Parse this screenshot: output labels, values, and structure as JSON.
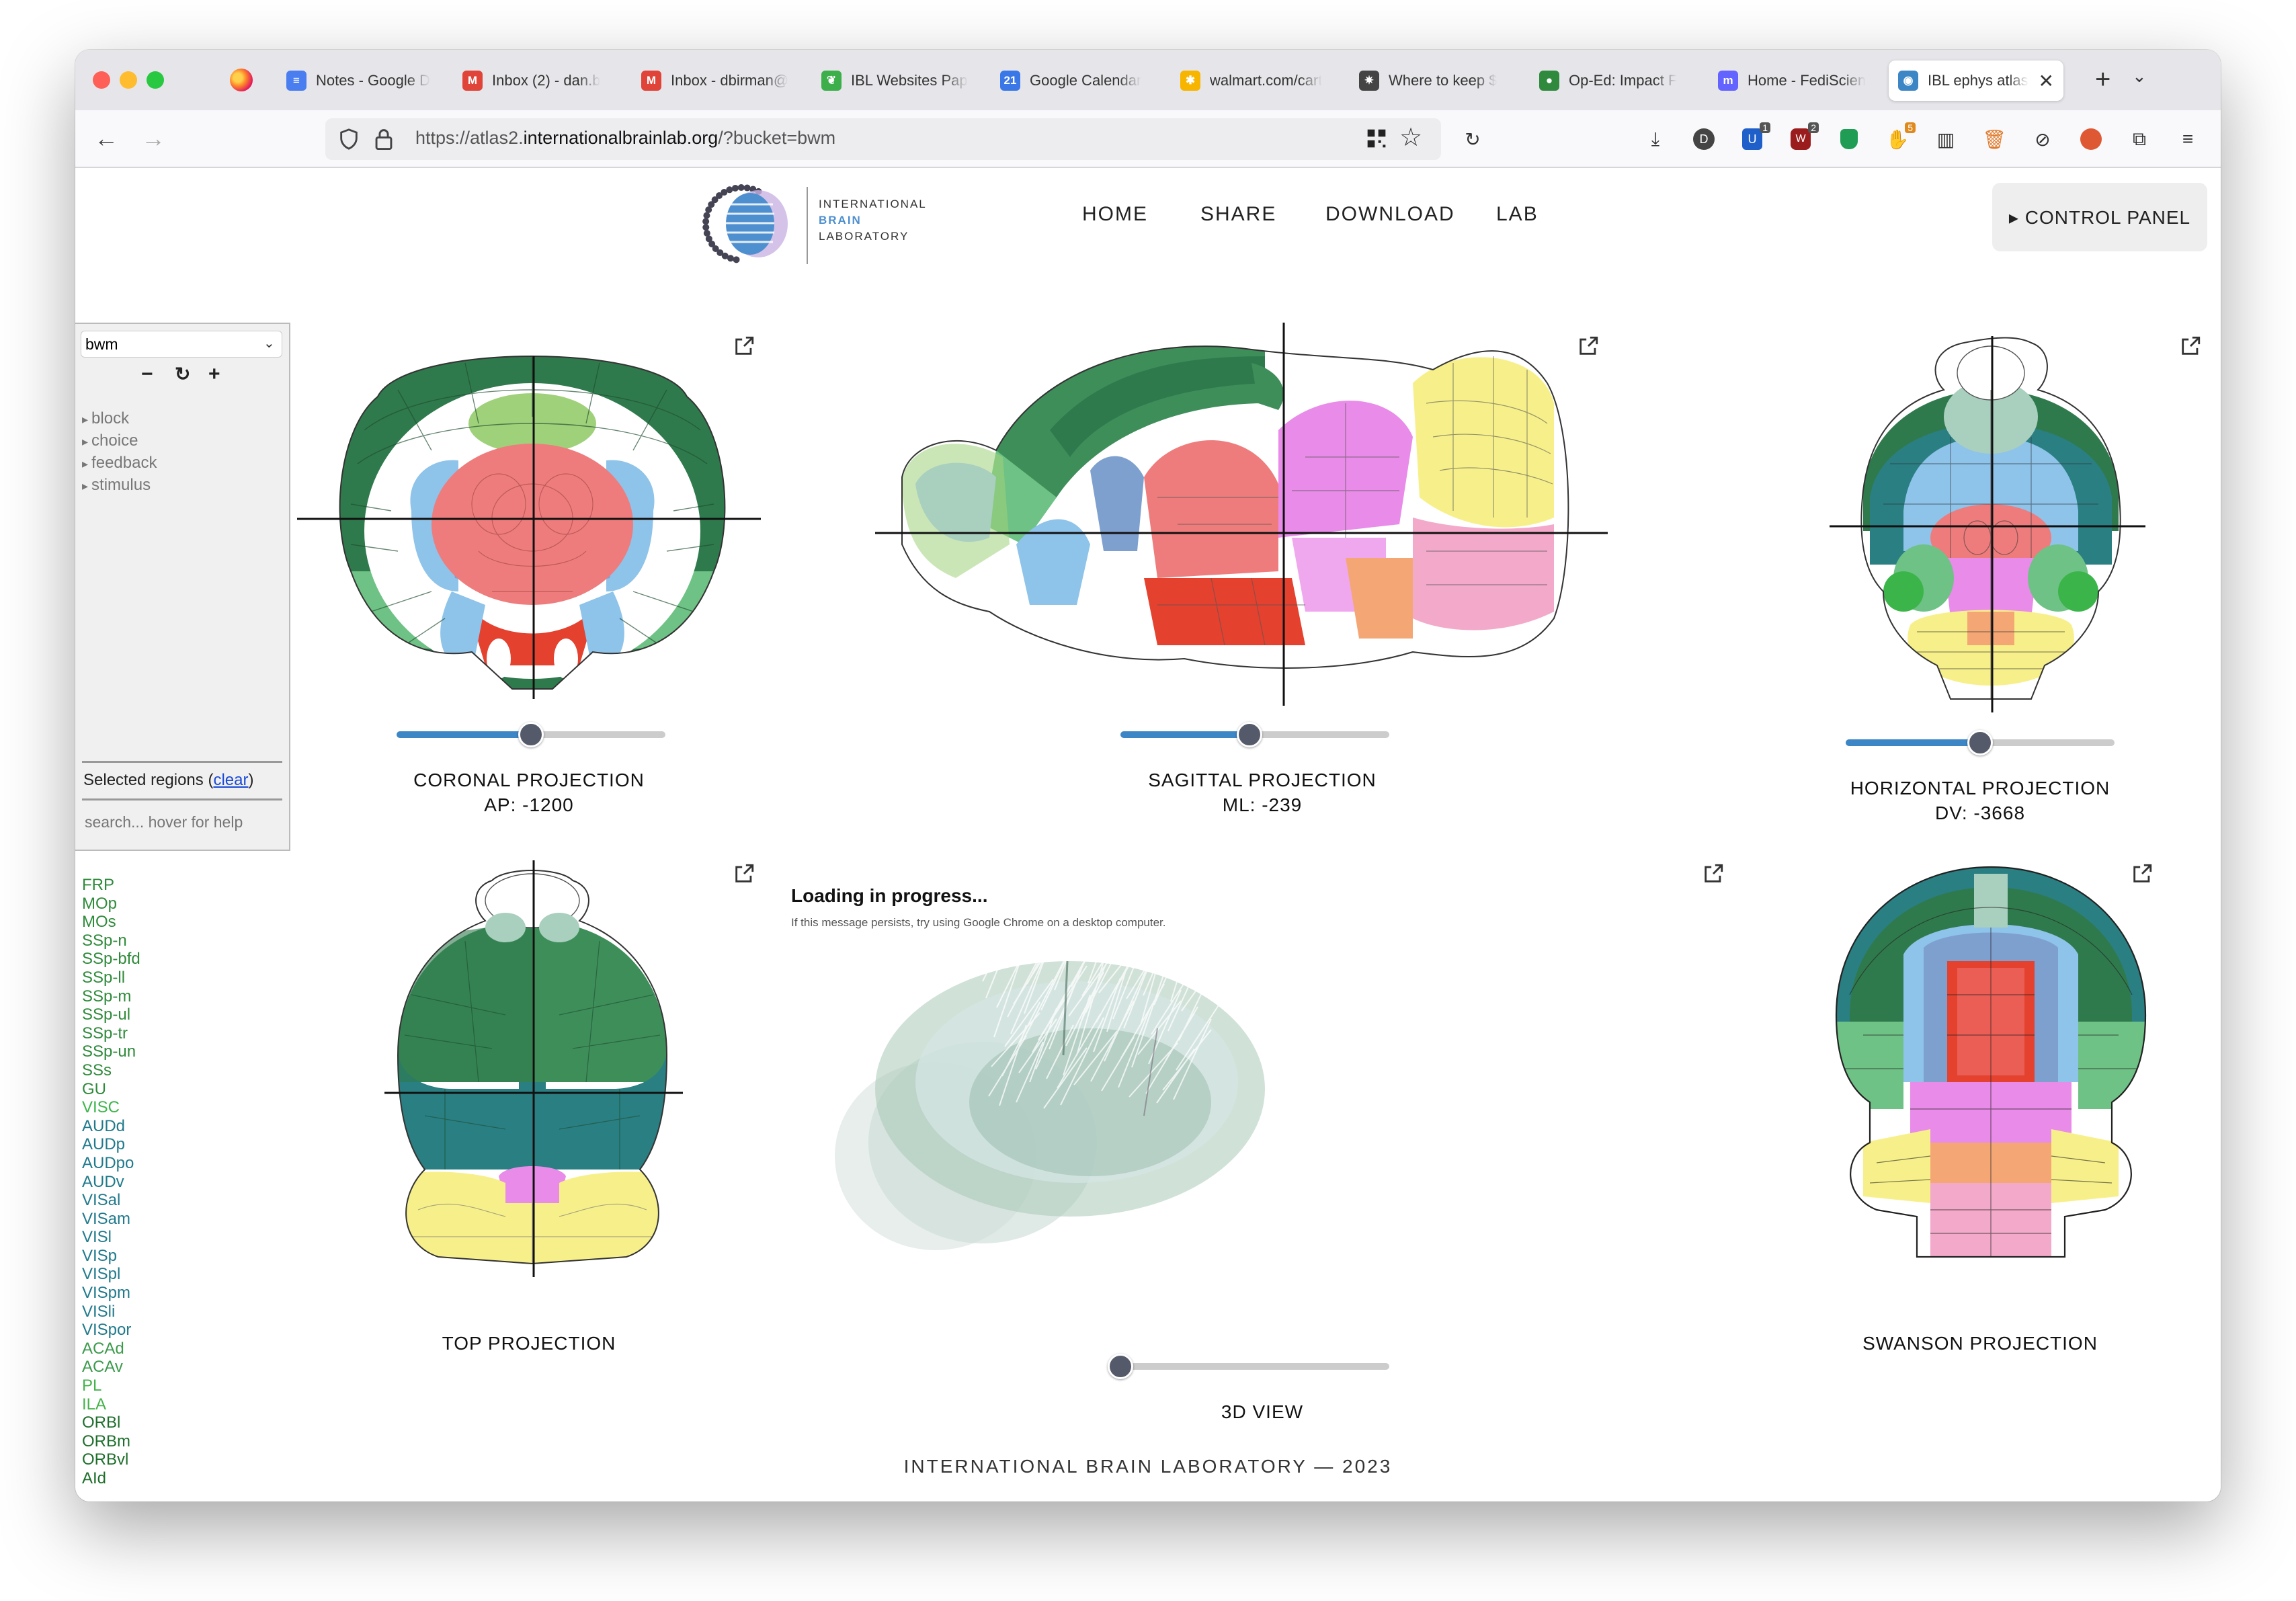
{
  "browser": {
    "tabs": [
      {
        "title": "Notes - Google D",
        "icon": "google-docs-icon",
        "color": "#4a7ef0",
        "glyph": "≡"
      },
      {
        "title": "Inbox (2) - dan.b",
        "icon": "gmail-icon",
        "color": "#e04338",
        "glyph": "M"
      },
      {
        "title": "Inbox - dbirman@",
        "icon": "gmail-icon",
        "color": "#e04338",
        "glyph": "M"
      },
      {
        "title": "IBL Websites Pap",
        "icon": "leaf-icon",
        "color": "#3cae4a",
        "glyph": "❦"
      },
      {
        "title": "Google Calendar",
        "icon": "calendar-icon",
        "color": "#3b78e7",
        "glyph": "21"
      },
      {
        "title": "walmart.com/cart",
        "icon": "walmart-icon",
        "color": "#f7b500",
        "glyph": "✱"
      },
      {
        "title": "Where to keep $",
        "icon": "site-icon",
        "color": "#444",
        "glyph": "✷"
      },
      {
        "title": "Op-Ed: Impact F",
        "icon": "site-icon",
        "color": "#2f8a3e",
        "glyph": "●"
      },
      {
        "title": "Home - FediScien",
        "icon": "mastodon-icon",
        "color": "#6364ff",
        "glyph": "m"
      },
      {
        "title": "IBL ephys atlas",
        "icon": "atlas-icon",
        "color": "#3d86c6",
        "glyph": "◉",
        "active": true
      }
    ],
    "url_prefix": "https://atlas2.",
    "url_domain": "internationalbrainlab.org",
    "url_suffix": "/?bucket=bwm",
    "toolbar_badges": [
      "1",
      "2",
      "5"
    ]
  },
  "site": {
    "logo_lines": [
      "INTERNATIONAL",
      "BRAIN",
      "LABORATORY"
    ],
    "nav": [
      "HOME",
      "SHARE",
      "DOWNLOAD",
      "LAB"
    ],
    "control_panel": "▸ CONTROL PANEL",
    "footer": "INTERNATIONAL BRAIN LABORATORY — 2023"
  },
  "panel": {
    "bucket": "bwm",
    "zoom_out": "−",
    "reset": "↻",
    "zoom_in": "+",
    "tree": [
      "block",
      "choice",
      "feedback",
      "stimulus"
    ],
    "selected_label": "Selected regions (",
    "clear": "clear",
    "selected_close": ")",
    "search_placeholder": "search... hover for help",
    "regions": [
      "FRP",
      "MOp",
      "MOs",
      "SSp-n",
      "SSp-bfd",
      "SSp-ll",
      "SSp-m",
      "SSp-ul",
      "SSp-tr",
      "SSp-un",
      "SSs",
      "GU",
      "VISC",
      "AUDd",
      "AUDp",
      "AUDpo",
      "AUDv",
      "VISal",
      "VISam",
      "VISl",
      "VISp",
      "VISpl",
      "VISpm",
      "VISli",
      "VISpor",
      "ACAd",
      "ACAv",
      "PL",
      "ILA",
      "ORBl",
      "ORBm",
      "ORBvl",
      "AId"
    ],
    "region_colors": [
      "#2e8b3a",
      "#2e8b3a",
      "#2e8b3a",
      "#2e8b3a",
      "#2e8b3a",
      "#2e8b3a",
      "#2e8b3a",
      "#2e8b3a",
      "#2e8b3a",
      "#2e8b3a",
      "#2e8b3a",
      "#2e8b3a",
      "#3bb54a",
      "#1f7a8c",
      "#1f7a8c",
      "#1f7a8c",
      "#1f7a8c",
      "#1f7a8c",
      "#1f7a8c",
      "#1f7a8c",
      "#1f7a8c",
      "#1f7a8c",
      "#1f7a8c",
      "#1f7a8c",
      "#1f7a8c",
      "#3a9a4a",
      "#3a9a4a",
      "#45b34a",
      "#45b34a",
      "#1d6e2a",
      "#1d6e2a",
      "#1d6e2a",
      "#1d6e2a"
    ]
  },
  "views": {
    "coronal": {
      "title": "CORONAL PROJECTION",
      "value": "AP: -1200",
      "slider": 0.5
    },
    "sagittal": {
      "title": "SAGITTAL PROJECTION",
      "value": "ML: -239",
      "slider": 0.48
    },
    "horizontal": {
      "title": "HORIZONTAL PROJECTION",
      "value": "DV: -3668",
      "slider": 0.5
    },
    "top": {
      "title": "TOP PROJECTION"
    },
    "view3d": {
      "title": "3D VIEW",
      "loading": "Loading in progress...",
      "loading_sub": "If this message persists, try using Google Chrome on a desktop computer.",
      "slider": 0.0
    },
    "swanson": {
      "title": "SWANSON PROJECTION"
    }
  },
  "colors": {
    "cortex_dark": "#2f7a4c",
    "cortex": "#3e8e5a",
    "cortex_light": "#6fc285",
    "olfactory": "#9fd17a",
    "thalamus": "#ef7c7c",
    "hypothal": "#e4412f",
    "striatum": "#8ec3ea",
    "hippo": "#7ea0cf",
    "midbrain": "#e98be8",
    "pons": "#f5b8dc",
    "medulla": "#f3a9c9",
    "cereb": "#f7f08a",
    "fiber": "#ffffff",
    "orange": "#f4a775",
    "teal": "#2a7f83",
    "accent": "#3d86c6"
  }
}
